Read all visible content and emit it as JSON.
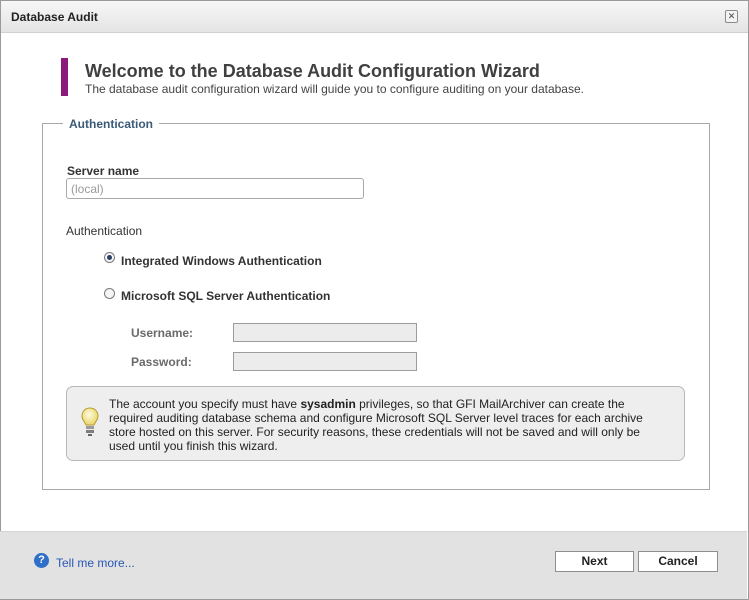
{
  "window": {
    "title": "Database Audit",
    "close_glyph": "✕"
  },
  "wizard": {
    "title": "Welcome to the Database Audit Configuration Wizard",
    "subtitle": "The database audit configuration wizard will guide you to configure auditing on your database.",
    "accent_color": "#8c1a7c"
  },
  "auth_section": {
    "legend": "Authentication",
    "server_name_label": "Server name",
    "server_name_value": "",
    "server_name_placeholder": "(local)",
    "authentication_label": "Authentication",
    "options": [
      {
        "label": "Integrated Windows Authentication",
        "selected": true
      },
      {
        "label": "Microsoft SQL Server Authentication",
        "selected": false
      }
    ],
    "username_label": "Username:",
    "username_value": "",
    "password_label": "Password:",
    "password_value": ""
  },
  "info": {
    "text_before": "The account you specify must have ",
    "bold": "sysadmin",
    "text_after": " privileges, so that GFI MailArchiver can create the required auditing database schema and configure Microsoft SQL Server level traces for each archive store hosted on this server. For security reasons, these credentials will not be saved and will only be used until you finish this wizard.",
    "icon": "lightbulb-icon"
  },
  "footer": {
    "help_glyph": "?",
    "help_link": "Tell me more...",
    "next_label": "Next",
    "cancel_label": "Cancel"
  }
}
